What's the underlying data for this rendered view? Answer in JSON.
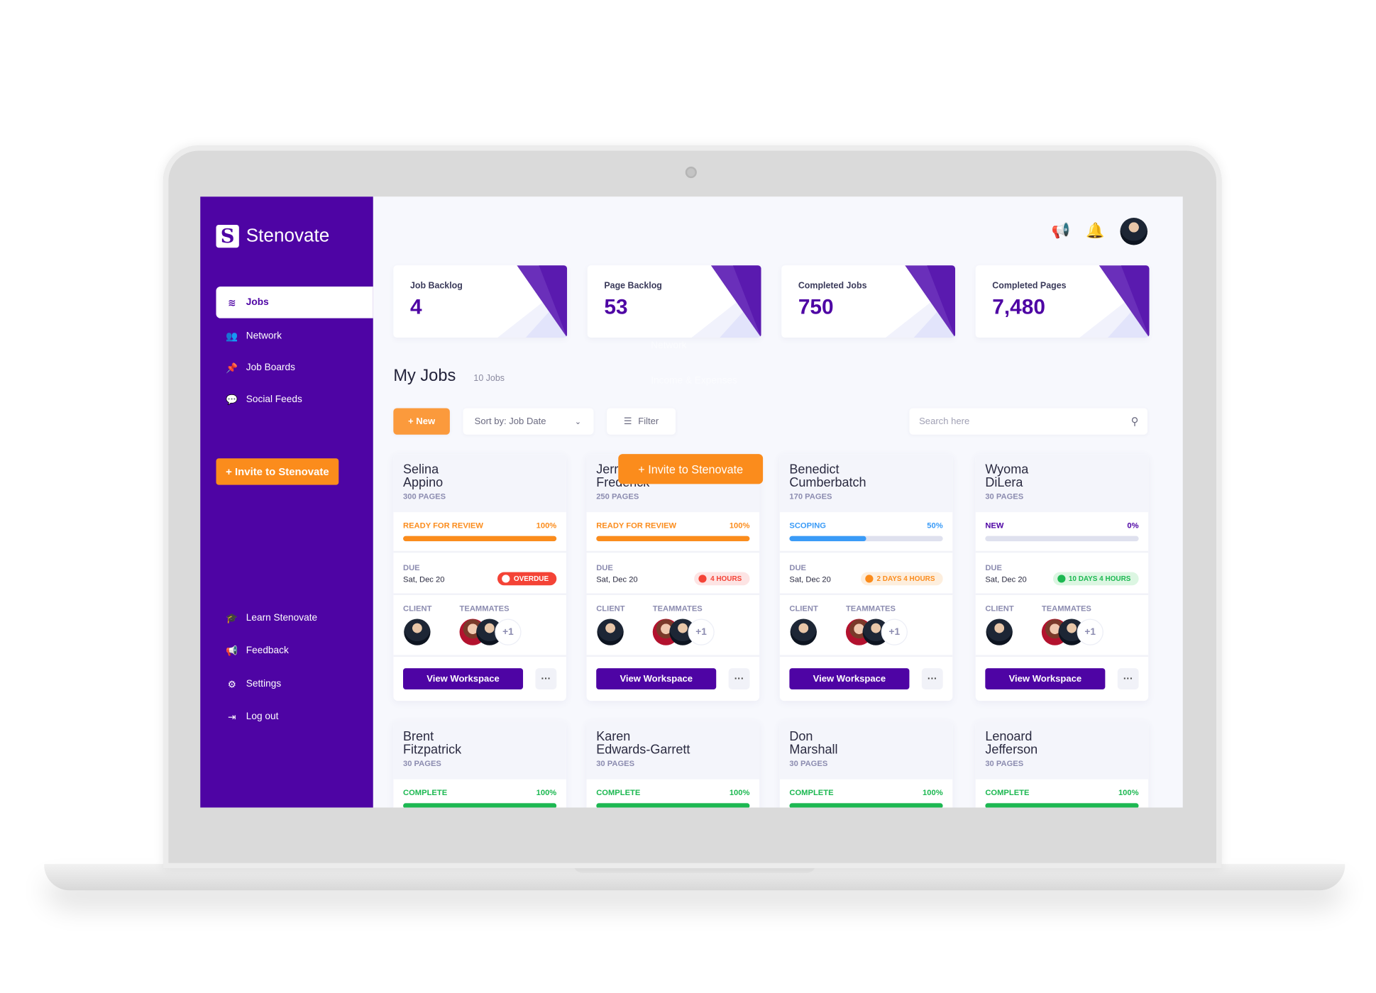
{
  "brand": {
    "name": "Stenovate",
    "logo_letter": "S"
  },
  "sidebar": {
    "items": [
      {
        "label": "Jobs",
        "icon": "stack-icon",
        "glyph": "≋",
        "active": true
      },
      {
        "label": "Network",
        "icon": "people-icon",
        "glyph": "👥"
      },
      {
        "label": "Job Boards",
        "icon": "pin-icon",
        "glyph": "📌"
      },
      {
        "label": "Social Feeds",
        "icon": "chat-icon",
        "glyph": "💬"
      }
    ],
    "invite_label": "+ Invite to Stenovate",
    "bottom_items": [
      {
        "label": "Learn Stenovate",
        "icon": "graduation-cap-icon",
        "glyph": "🎓"
      },
      {
        "label": "Feedback",
        "icon": "megaphone-icon",
        "glyph": "📢"
      },
      {
        "label": "Settings",
        "icon": "gear-icon",
        "glyph": "⚙"
      },
      {
        "label": "Log out",
        "icon": "logout-icon",
        "glyph": "⇥"
      }
    ]
  },
  "ghost": {
    "network": "Network",
    "income": "Income & Expenses"
  },
  "stats": [
    {
      "label": "Job Backlog",
      "value": "4"
    },
    {
      "label": "Page Backlog",
      "value": "53"
    },
    {
      "label": "Completed Jobs",
      "value": "750"
    },
    {
      "label": "Completed Pages",
      "value": "7,480"
    }
  ],
  "main": {
    "title": "My Jobs",
    "count": "10 Jobs",
    "new_label": "+  New",
    "sort_label": "Sort by: Job Date",
    "filter_label": "Filter",
    "search_placeholder": "Search here",
    "floating_invite": "+ Invite to Stenovate"
  },
  "colors": {
    "brand": "#4e04a4",
    "accent": "#fb8c1c",
    "review": "#fb8c1c",
    "scoping": "#3a9bf7",
    "new": "#4e04a4",
    "complete": "#1cb851",
    "overdue": "#f44336"
  },
  "card_labels": {
    "due": "DUE",
    "client": "CLIENT",
    "teammates": "TEAMMATES",
    "extra": "+1",
    "view": "View Workspace",
    "more": "···"
  },
  "jobs": [
    {
      "first": "Selina",
      "last": "Appino",
      "pages": "300 PAGES",
      "status": "READY FOR REVIEW",
      "pct": 100,
      "color": "#fb8c1c",
      "due": "Sat, Dec 20",
      "pill": "OVERDUE",
      "pill_bg": "#f44336",
      "pill_fg": "#ffffff",
      "dot": "#ffffff"
    },
    {
      "first": "Jerry",
      "last": "Frederick",
      "pages": "250 PAGES",
      "status": "READY FOR REVIEW",
      "pct": 100,
      "color": "#fb8c1c",
      "due": "Sat, Dec 20",
      "pill": "4 HOURS",
      "pill_bg": "#fde4e4",
      "pill_fg": "#f44336",
      "dot": "#f44336"
    },
    {
      "first": "Benedict",
      "last": "Cumberbatch",
      "pages": "170 PAGES",
      "status": "SCOPING",
      "pct": 50,
      "color": "#3a9bf7",
      "due": "Sat, Dec 20",
      "pill": "2 DAYS  4 HOURS",
      "pill_bg": "#fdeedd",
      "pill_fg": "#fb8c1c",
      "dot": "#fb8c1c"
    },
    {
      "first": "Wyoma",
      "last": "DiLera",
      "pages": "30 PAGES",
      "status": "NEW",
      "pct": 0,
      "color": "#4e04a4",
      "due": "Sat, Dec 20",
      "pill": "10 DAYS  4 HOURS",
      "pill_bg": "#dcf6e2",
      "pill_fg": "#1cb851",
      "dot": "#1cb851"
    },
    {
      "first": "Brent",
      "last": "Fitzpatrick",
      "pages": "30 PAGES",
      "status": "COMPLETE",
      "pct": 100,
      "color": "#1cb851"
    },
    {
      "first": "Karen",
      "last": "Edwards-Garrett",
      "pages": "30 PAGES",
      "status": "COMPLETE",
      "pct": 100,
      "color": "#1cb851"
    },
    {
      "first": "Don",
      "last": "Marshall",
      "pages": "30 PAGES",
      "status": "COMPLETE",
      "pct": 100,
      "color": "#1cb851"
    },
    {
      "first": "Lenoard",
      "last": "Jefferson",
      "pages": "30 PAGES",
      "status": "COMPLETE",
      "pct": 100,
      "color": "#1cb851"
    }
  ]
}
